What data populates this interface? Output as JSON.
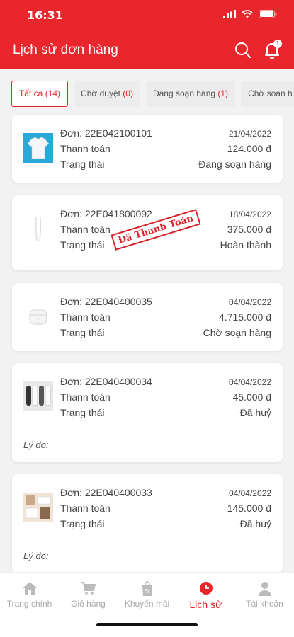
{
  "status_bar": {
    "time": "16:31"
  },
  "header": {
    "title": "Lịch sử đơn hàng",
    "notification_count": "1"
  },
  "tabs": [
    {
      "label": "Tất ca",
      "count": "(14)"
    },
    {
      "label": "Chờ duyệt",
      "count": "(0)"
    },
    {
      "label": "Đang soạn hàng",
      "count": "(1)"
    },
    {
      "label": "Chờ soạn h",
      "count": ""
    }
  ],
  "labels": {
    "order": "Đơn:",
    "payment": "Thanh toán",
    "status": "Trạng thái",
    "reason": "Lý do:"
  },
  "orders": [
    {
      "code": "22E042100101",
      "date": "21/04/2022",
      "amount": "124.000 đ",
      "status": "Đang soạn hàng",
      "thumb": "tshirt"
    },
    {
      "code": "22E041800092",
      "date": "18/04/2022",
      "amount": "375.000 đ",
      "status": "Hoàn thành",
      "thumb": "earphones",
      "stamp": "Đã Thanh Toán"
    },
    {
      "code": "22E040400035",
      "date": "04/04/2022",
      "amount": "4.715.000 đ",
      "status": "Chờ soạn hàng",
      "thumb": "airpods"
    },
    {
      "code": "22E040400034",
      "date": "04/04/2022",
      "amount": "45.000 đ",
      "status": "Đã huỷ",
      "thumb": "socks"
    },
    {
      "code": "22E040400033",
      "date": "04/04/2022",
      "amount": "145.000 đ",
      "status": "Đã huỷ",
      "thumb": "products"
    }
  ],
  "bottom_nav": [
    {
      "label": "Trang chính",
      "icon": "home-icon"
    },
    {
      "label": "Giỏ hàng",
      "icon": "cart-icon"
    },
    {
      "label": "Khuyến mãi",
      "icon": "promo-icon"
    },
    {
      "label": "Lịch sử",
      "icon": "clock-icon"
    },
    {
      "label": "Tài khoản",
      "icon": "user-icon"
    }
  ],
  "colors": {
    "brand": "#e8262c",
    "muted_status": "#999999",
    "cancel_status": "#e8262c"
  }
}
